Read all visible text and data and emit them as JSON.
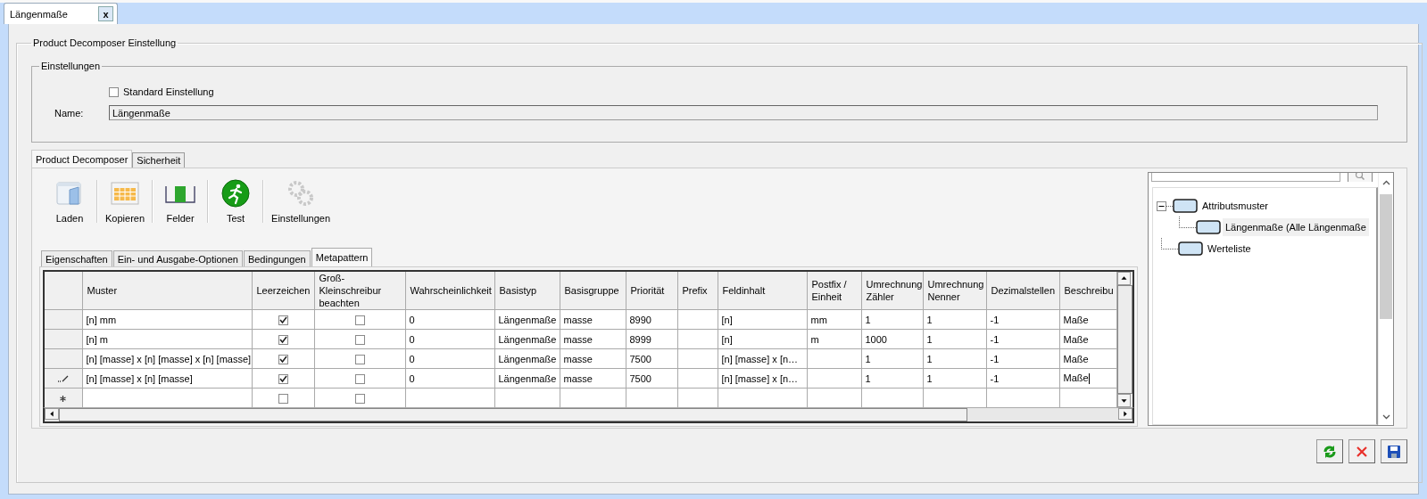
{
  "document_tab": {
    "label": "Längenmaße",
    "close": "x"
  },
  "main_group": {
    "title": "Product Decomposer Einstellung"
  },
  "settings_group": {
    "title": "Einstellungen",
    "standard": {
      "label": "Standard Einstellung",
      "checked": false
    },
    "name_label": "Name:",
    "name_value": "Längenmaße"
  },
  "tabs": [
    {
      "label": "Product Decomposer",
      "selected": true
    },
    {
      "label": "Sicherheit",
      "selected": false
    }
  ],
  "toolbar": [
    {
      "kind": "open",
      "label": "Laden"
    },
    {
      "kind": "copy",
      "label": "Kopieren"
    },
    {
      "kind": "fields",
      "label": "Felder"
    },
    {
      "kind": "run",
      "label": "Test"
    },
    {
      "kind": "settings",
      "label": "Einstellungen",
      "disabled": true
    }
  ],
  "sub_tabs": [
    {
      "label": "Eigenschaften",
      "selected": false
    },
    {
      "label": "Ein- und Ausgabe-Optionen",
      "selected": false
    },
    {
      "label": "Bedingungen",
      "selected": false
    },
    {
      "label": "Metapattern",
      "selected": true
    }
  ],
  "table": {
    "columns": [
      "Muster",
      "Leerzeichen",
      "Groß-Kleinschreibur beachten",
      "Wahrscheinlichkeit",
      "Basistyp",
      "Basisgruppe",
      "Priorität",
      "Prefix",
      "Feldinhalt",
      "Postfix / Einheit",
      "Umrechnung Zähler",
      "Umrechnung Nenner",
      "Dezimalstellen",
      "Beschreibu"
    ],
    "rows": [
      {
        "kind": "data",
        "editing": false,
        "muster": "[n] mm",
        "leerzeichen": true,
        "gross_klein": false,
        "wahrscheinlichkeit": "0",
        "basistyp": "Längenmaße",
        "basisgruppe": "masse",
        "prioritaet": "8990",
        "feldinhalt": "[n]",
        "postfix": "mm",
        "zaehler": "1",
        "nenner": "1",
        "dezimalstellen": "-1",
        "beschreibung": "Maße"
      },
      {
        "kind": "data",
        "editing": false,
        "muster": "[n] m",
        "leerzeichen": true,
        "gross_klein": false,
        "wahrscheinlichkeit": "0",
        "basistyp": "Längenmaße",
        "basisgruppe": "masse",
        "prioritaet": "8999",
        "feldinhalt": "[n]",
        "postfix": "m",
        "zaehler": "1000",
        "nenner": "1",
        "dezimalstellen": "-1",
        "beschreibung": "Maße"
      },
      {
        "kind": "data",
        "editing": false,
        "muster": "[n] [masse] x [n] [masse] x [n] [masse]",
        "leerzeichen": true,
        "gross_klein": false,
        "wahrscheinlichkeit": "0",
        "basistyp": "Längenmaße",
        "basisgruppe": "masse",
        "prioritaet": "7500",
        "feldinhalt": "[n] [masse] x [n…",
        "zaehler": "1",
        "nenner": "1",
        "dezimalstellen": "-1",
        "beschreibung": "Maße"
      },
      {
        "kind": "data",
        "editing": true,
        "muster": "[n] [masse] x [n] [masse]",
        "leerzeichen": true,
        "gross_klein": false,
        "wahrscheinlichkeit": "0",
        "basistyp": "Längenmaße",
        "basisgruppe": "masse",
        "prioritaet": "7500",
        "feldinhalt": "[n] [masse] x [n…",
        "zaehler": "1",
        "nenner": "1",
        "dezimalstellen": "-1",
        "beschreibung": "Maße"
      },
      {
        "kind": "new",
        "editing": false,
        "leerzeichen": false,
        "gross_klein": false
      }
    ]
  },
  "tree": [
    {
      "label": "Attributsmuster",
      "expanded": true,
      "selected": false,
      "children": [
        {
          "label": "Längenmaße (Alle Längenmaße",
          "selected": true
        }
      ]
    },
    {
      "label": "Werteliste",
      "selected": false
    }
  ],
  "buttons": [
    {
      "kind": "refresh"
    },
    {
      "kind": "cancel"
    },
    {
      "kind": "save"
    }
  ]
}
